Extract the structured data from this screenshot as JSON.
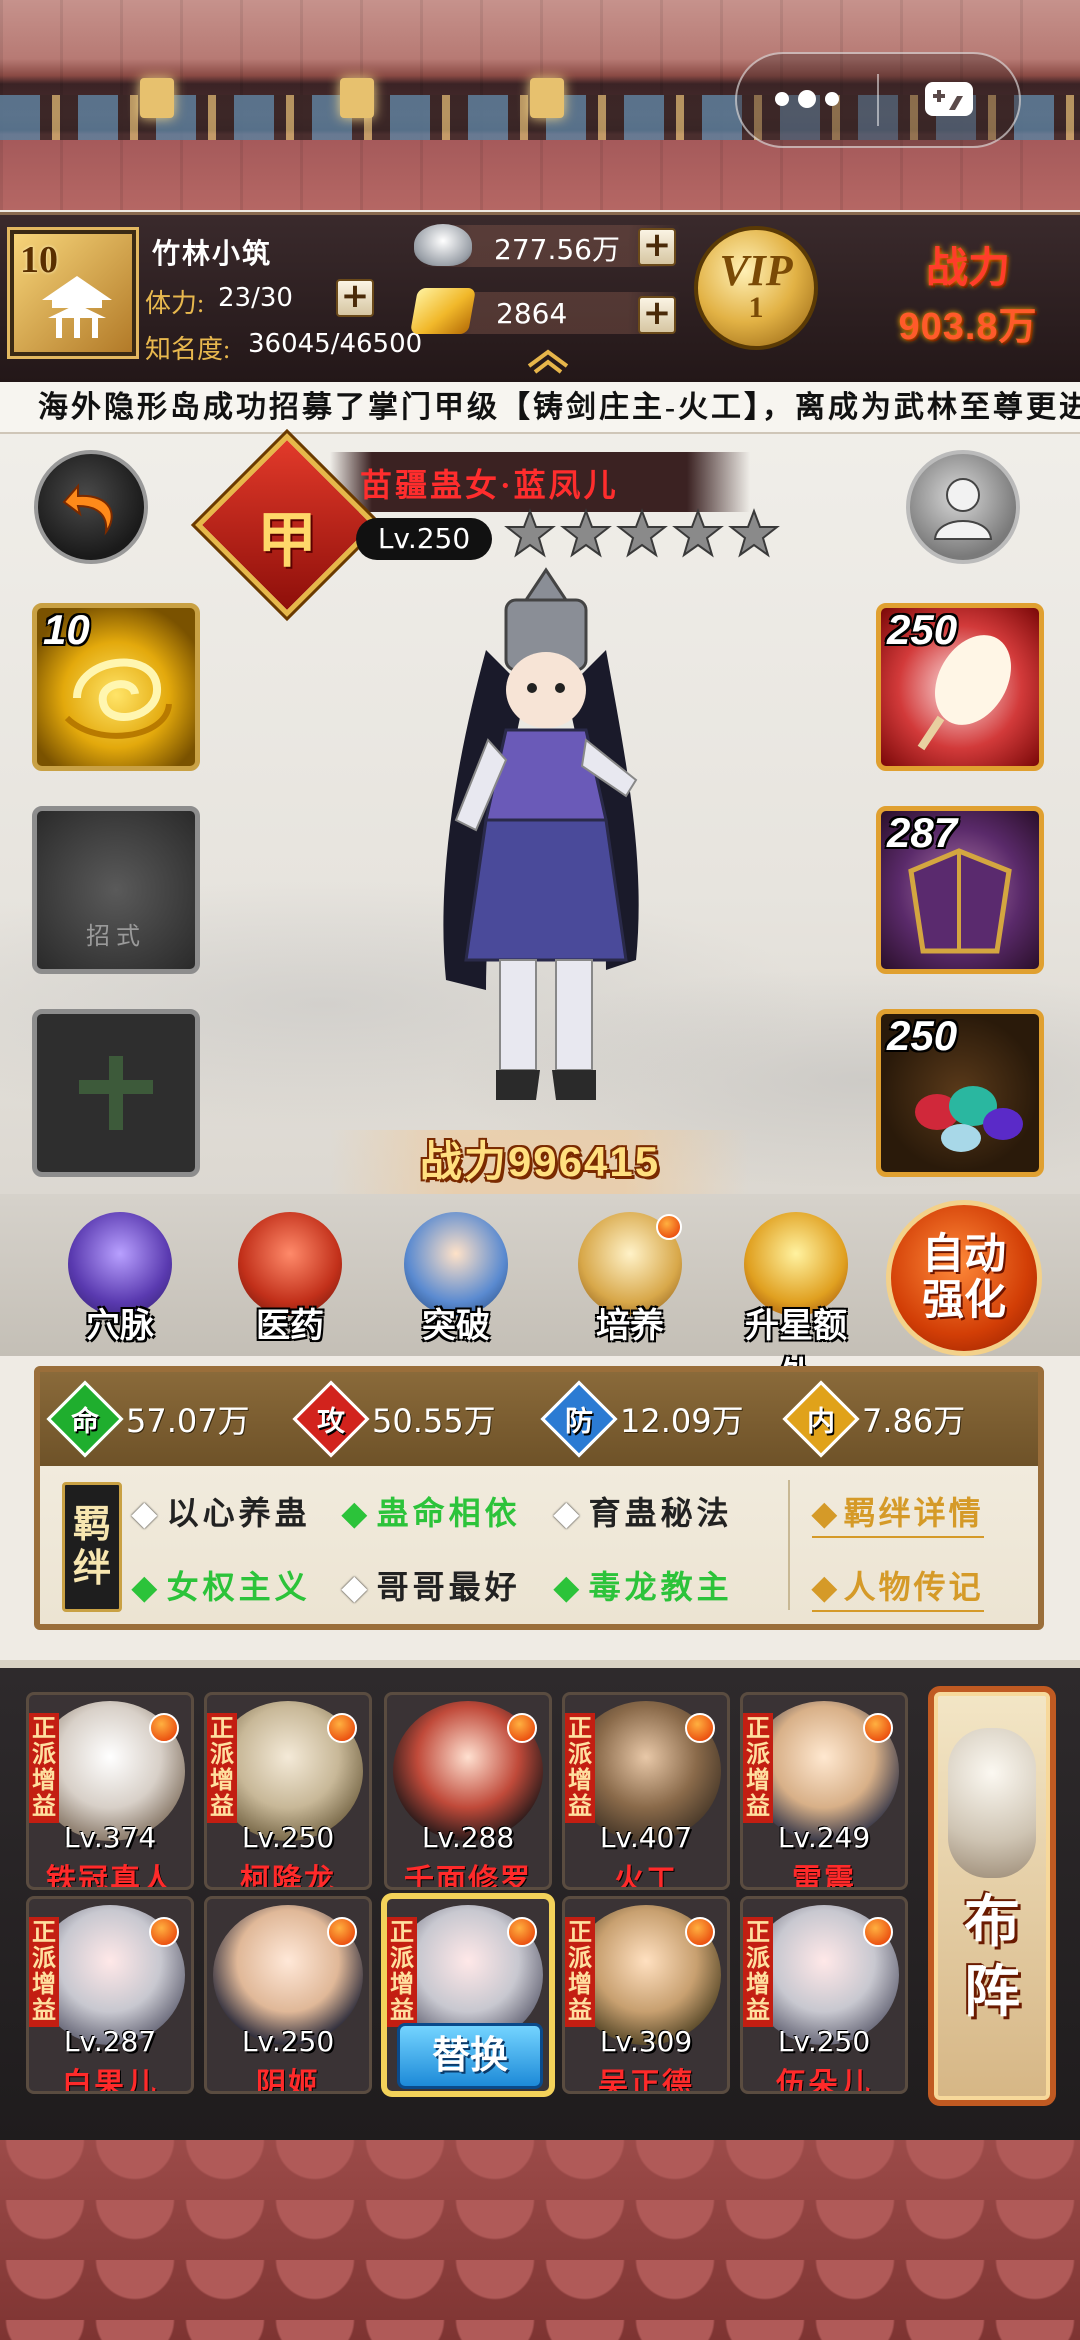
{
  "miniapp": {
    "more_icon": "more-dots-icon",
    "exit_icon": "gamepad-exit-icon"
  },
  "player": {
    "rank": "10",
    "name": "竹林小筑",
    "stamina_label": "体力:",
    "stamina": "23/30",
    "fame_label": "知名度:",
    "fame": "36045/46500",
    "silver": "277.56万",
    "gold": "2864",
    "vip_label": "VIP",
    "vip_level": "1",
    "power_label": "战力",
    "power": "903.8万"
  },
  "marquee": "海外隐形岛成功招募了掌门甲级【铸剑庄主-火工】，离成为武林至尊更进一步",
  "hero": {
    "rank_char": "甲",
    "name": "苗疆蛊女·蓝凤儿",
    "level": "Lv.250",
    "stars": 5,
    "skill_slot_level": "10",
    "empty_skill_label": "招式",
    "equipment_levels": [
      "250",
      "287",
      "250"
    ],
    "power_label": "战力",
    "power": "996415"
  },
  "functions": [
    {
      "label": "穴脉",
      "icon": "meridian-icon",
      "badge": false
    },
    {
      "label": "医药",
      "icon": "medicine-icon",
      "badge": false
    },
    {
      "label": "突破",
      "icon": "breakthrough-icon",
      "badge": false
    },
    {
      "label": "培养",
      "icon": "scroll-training-icon",
      "badge": true
    },
    {
      "label": "升星额外",
      "icon": "star-up-icon",
      "badge": false
    }
  ],
  "auto_strengthen": {
    "line1": "自动",
    "line2": "强化"
  },
  "stats": {
    "hp": {
      "char": "命",
      "value": "57.07万",
      "color": "#1fae2e"
    },
    "atk": {
      "char": "攻",
      "value": "50.55万",
      "color": "#d2231d"
    },
    "def": {
      "char": "防",
      "value": "12.09万",
      "color": "#2b7bd3"
    },
    "inner": {
      "char": "内",
      "value": "7.86万",
      "color": "#e0a21a"
    }
  },
  "bonds": {
    "tag": [
      "羁",
      "绊"
    ],
    "items": [
      {
        "text": "以心养蛊",
        "active": false
      },
      {
        "text": "蛊命相依",
        "active": true
      },
      {
        "text": "育蛊秘法",
        "active": false
      },
      {
        "text": "女权主义",
        "active": true
      },
      {
        "text": "哥哥最好",
        "active": false
      },
      {
        "text": "毒龙教主",
        "active": true
      }
    ],
    "detail_link": "羁绊详情",
    "bio_link": "人物传记"
  },
  "roster": [
    {
      "level": "Lv.374",
      "name": "铁冠真人",
      "tag": "正派增益",
      "selected": false
    },
    {
      "level": "Lv.250",
      "name": "柯降龙",
      "tag": "正派增益",
      "selected": false
    },
    {
      "level": "Lv.288",
      "name": "千面修罗",
      "tag": "",
      "selected": false
    },
    {
      "level": "Lv.407",
      "name": "火工",
      "tag": "正派增益",
      "selected": false
    },
    {
      "level": "Lv.249",
      "name": "雷震",
      "tag": "正派增益",
      "selected": false
    },
    {
      "level": "Lv.287",
      "name": "白果儿",
      "tag": "正派增益",
      "selected": false
    },
    {
      "level": "Lv.250",
      "name": "阴姬",
      "tag": "",
      "selected": false
    },
    {
      "level": "",
      "name": "",
      "tag": "正派增益",
      "selected": true,
      "action": "替换"
    },
    {
      "level": "Lv.309",
      "name": "吴正德",
      "tag": "正派增益",
      "selected": false
    },
    {
      "level": "Lv.250",
      "name": "伍朵儿",
      "tag": "正派增益",
      "selected": false
    }
  ],
  "formation": {
    "chars": [
      "布",
      "阵"
    ]
  }
}
